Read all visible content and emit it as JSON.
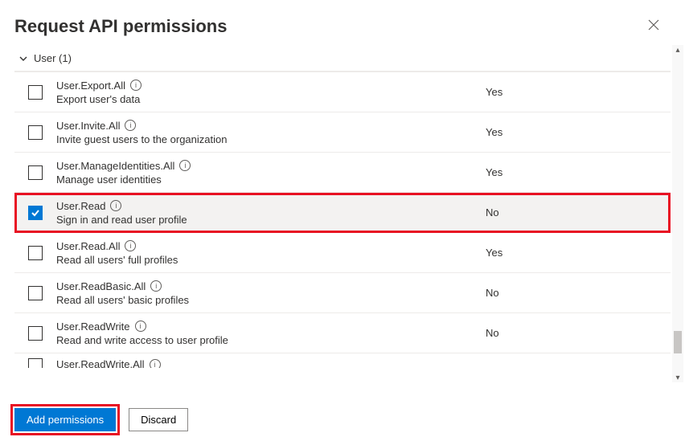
{
  "header": {
    "title": "Request API permissions"
  },
  "group": {
    "label": "User (1)"
  },
  "columns": {
    "consent_header": ""
  },
  "permissions": [
    {
      "name": "User.Export.All",
      "desc": "Export user's data",
      "consent": "Yes",
      "checked": false
    },
    {
      "name": "User.Invite.All",
      "desc": "Invite guest users to the organization",
      "consent": "Yes",
      "checked": false
    },
    {
      "name": "User.ManageIdentities.All",
      "desc": "Manage user identities",
      "consent": "Yes",
      "checked": false
    },
    {
      "name": "User.Read",
      "desc": "Sign in and read user profile",
      "consent": "No",
      "checked": true,
      "highlighted": true
    },
    {
      "name": "User.Read.All",
      "desc": "Read all users' full profiles",
      "consent": "Yes",
      "checked": false
    },
    {
      "name": "User.ReadBasic.All",
      "desc": "Read all users' basic profiles",
      "consent": "No",
      "checked": false
    },
    {
      "name": "User.ReadWrite",
      "desc": "Read and write access to user profile",
      "consent": "No",
      "checked": false
    }
  ],
  "partial": {
    "name": "User.ReadWrite.All"
  },
  "footer": {
    "add": "Add permissions",
    "discard": "Discard"
  }
}
